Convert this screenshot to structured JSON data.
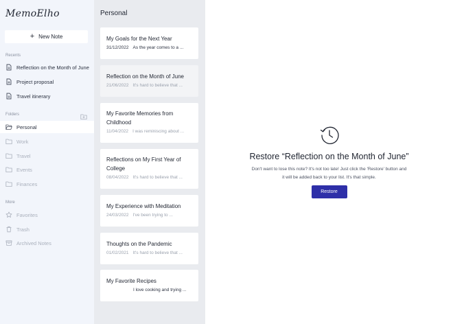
{
  "sidebar": {
    "logo": "MemoElho",
    "new_note_label": "New Note",
    "recents_label": "Recents",
    "recents": [
      {
        "label": "Reflection on the Month of June",
        "icon": "document-icon"
      },
      {
        "label": "Project proposal",
        "icon": "document-icon"
      },
      {
        "label": "Travel itinerary",
        "icon": "document-icon"
      }
    ],
    "folders_label": "Folders",
    "folders": [
      {
        "label": "Personal",
        "icon": "folder-open-icon",
        "active": true
      },
      {
        "label": "Work",
        "icon": "folder-icon"
      },
      {
        "label": "Travel",
        "icon": "folder-icon"
      },
      {
        "label": "Events",
        "icon": "folder-icon"
      },
      {
        "label": "Finances",
        "icon": "folder-icon"
      }
    ],
    "more_label": "More",
    "more": [
      {
        "label": "Favorites",
        "icon": "star-icon"
      },
      {
        "label": "Trash",
        "icon": "trash-icon"
      },
      {
        "label": "Archived Notes",
        "icon": "archive-icon"
      }
    ]
  },
  "list": {
    "title": "Personal",
    "notes": [
      {
        "title": "My Goals for the Next Year",
        "date": "31/12/2022",
        "preview": "As the year comes to a ..."
      },
      {
        "title": "Reflection on the Month of June",
        "date": "21/06/2022",
        "preview": "It's hard to believe that ..."
      },
      {
        "title": "My Favorite Memories from Childhood",
        "date": "11/04/2022",
        "preview": "I was reminiscing about ..."
      },
      {
        "title": "Reflections on My First Year of College",
        "date": "08/04/2022",
        "preview": "It's hard to believe that ..."
      },
      {
        "title": "My Experience with Meditation",
        "date": "24/03/2022",
        "preview": "I've been trying to ..."
      },
      {
        "title": "Thoughts on the Pandemic",
        "date": "01/02/2021",
        "preview": "It's hard to believe that ..."
      },
      {
        "title": "My Favorite Recipes",
        "date": "",
        "preview": "I love cooking and trying ..."
      }
    ]
  },
  "main": {
    "restore_title": "Restore “Reflection on the Month of June”",
    "restore_description": "Don't want to lose this note? It's not too late! Just click the 'Restore' button and it will be added back to your list. It's that simple.",
    "restore_button": "Restore"
  },
  "colors": {
    "accent": "#2e2fa8",
    "sidebar_bg": "#f2f5fb",
    "list_bg": "#e9ebef"
  }
}
